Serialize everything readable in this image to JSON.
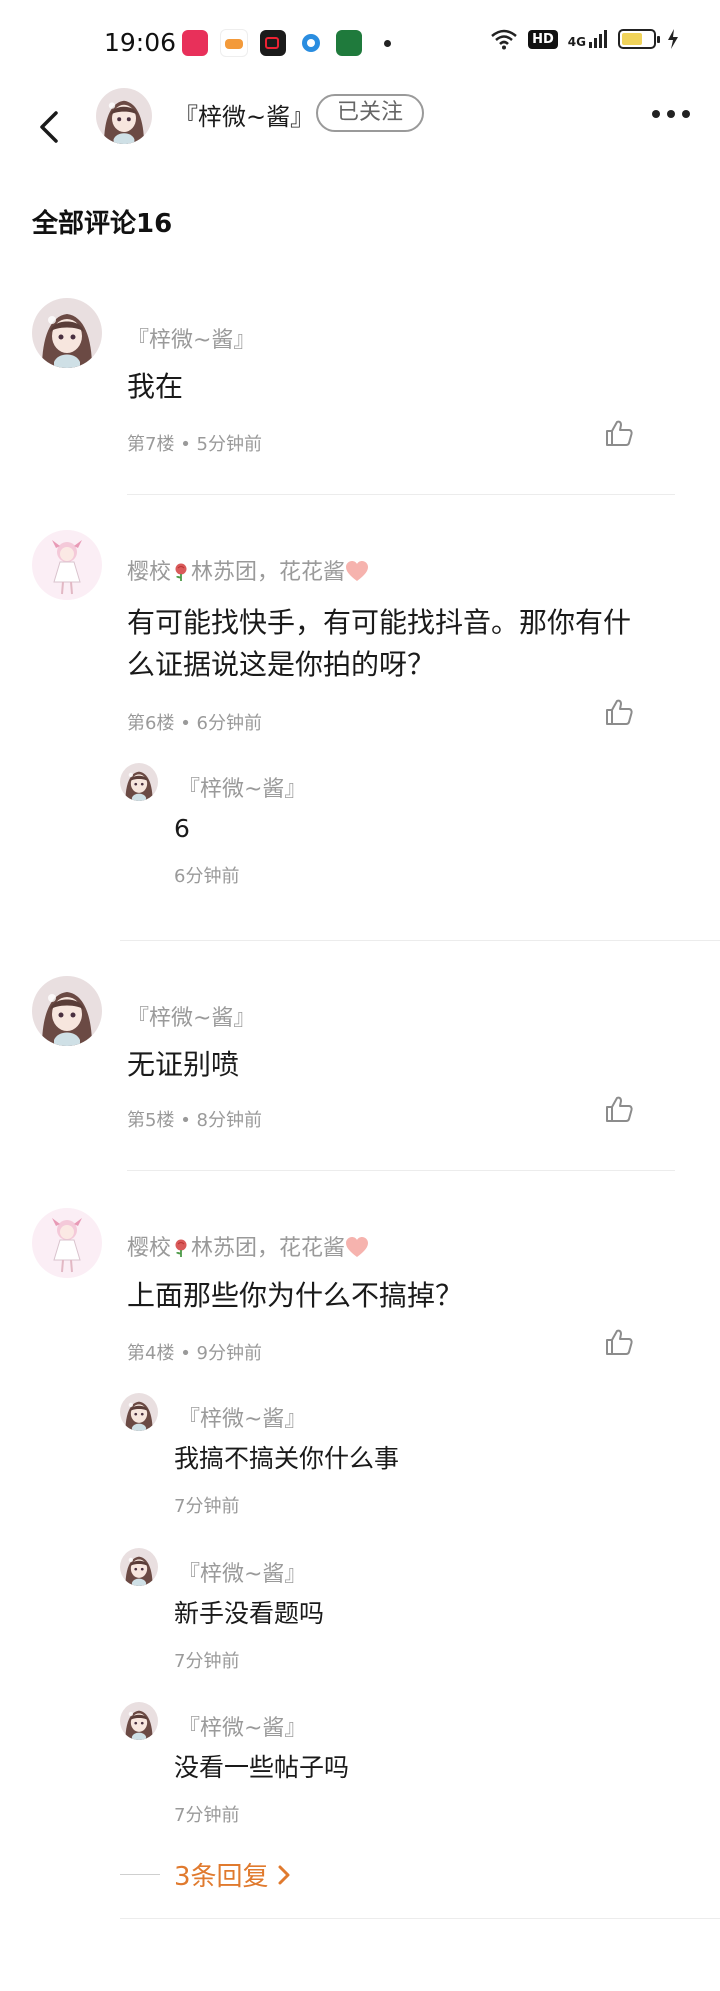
{
  "status_bar": {
    "time": "19:06",
    "hd": "HD",
    "network": "4G"
  },
  "header": {
    "user_name": "『梓微~酱』",
    "follow_label": "已关注"
  },
  "section_title": "全部评论16",
  "colors": {
    "accent": "#e07a2e",
    "muted": "#9a9a9a",
    "text": "#1a1a1a"
  },
  "comments": [
    {
      "author": "『梓微~酱』",
      "text": "我在",
      "floor": "第7楼",
      "time": "5分钟前"
    },
    {
      "author_prefix": "樱校",
      "author_mid": "林苏团，花花酱",
      "text": "有可能找快手，有可能找抖音。那你有什么证据说这是你拍的呀？",
      "floor": "第6楼",
      "time": "6分钟前",
      "replies": [
        {
          "author": "『梓微~酱』",
          "text": "6",
          "time": "6分钟前"
        }
      ]
    },
    {
      "author": "『梓微~酱』",
      "text": "无证别喷",
      "floor": "第5楼",
      "time": "8分钟前"
    },
    {
      "author_prefix": "樱校",
      "author_mid": "林苏团，花花酱",
      "text": "上面那些你为什么不搞掉？",
      "floor": "第4楼",
      "time": "9分钟前",
      "replies": [
        {
          "author": "『梓微~酱』",
          "text": "我搞不搞关你什么事",
          "time": "7分钟前"
        },
        {
          "author": "『梓微~酱』",
          "text": "新手没看题吗",
          "time": "7分钟前"
        },
        {
          "author": "『梓微~酱』",
          "text": "没看一些帖子吗",
          "time": "7分钟前"
        }
      ],
      "more_replies": "3条回复"
    }
  ],
  "separator": "•",
  "icons": [
    "back-arrow-icon",
    "more-dots-icon",
    "thumbs-up-icon",
    "chevron-right-icon",
    "rose-icon",
    "heart-icon",
    "wifi-icon",
    "signal-icon",
    "battery-icon",
    "charging-icon"
  ]
}
